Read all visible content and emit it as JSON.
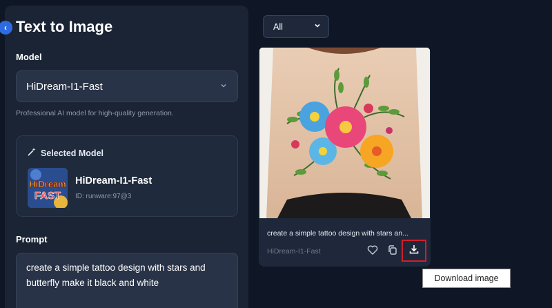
{
  "panel": {
    "title": "Text to Image",
    "model_label": "Model",
    "model_value": "HiDream-I1-Fast",
    "model_helper": "Professional AI model for high-quality generation.",
    "selected_heading": "Selected Model",
    "selected_name": "HiDream-I1-Fast",
    "selected_id": "ID: runware:97@3",
    "thumb_text": "HiDream FAST",
    "prompt_label": "Prompt",
    "prompt_value": "create a simple tattoo design with stars and butterfly make it black and white"
  },
  "filter": {
    "selected": "All"
  },
  "result": {
    "caption": "create a simple tattoo design with stars an...",
    "model": "HiDream-I1-Fast"
  },
  "tooltip": "Download image",
  "icons": {
    "collapse": "chevron-left-icon",
    "wand": "magic-wand-icon",
    "heart": "heart-icon",
    "copy": "copy-icon",
    "download": "download-icon"
  },
  "colors": {
    "accent": "#2d6be4",
    "highlight": "#d11f2b",
    "background": "#0f1726",
    "panel": "#1b2434"
  }
}
